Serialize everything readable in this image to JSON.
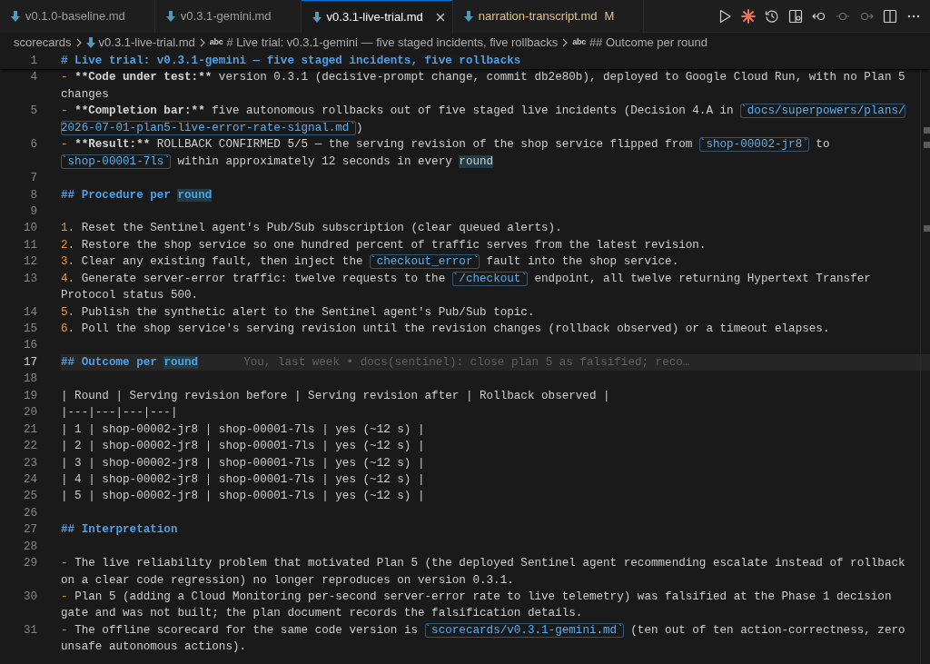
{
  "tabs": [
    {
      "label": "v0.1.0-baseline.md",
      "selected": false,
      "modified": false
    },
    {
      "label": "v0.3.1-gemini.md",
      "selected": false,
      "modified": false
    },
    {
      "label": "v0.3.1-live-trial.md",
      "selected": true,
      "modified": false
    },
    {
      "label": "narration-transcript.md",
      "selected": false,
      "modified": true,
      "status": "M"
    }
  ],
  "breadcrumbs": [
    {
      "kind": "folder",
      "label": "scorecards"
    },
    {
      "kind": "file",
      "label": "v0.3.1-live-trial.md"
    },
    {
      "kind": "symbol",
      "glyph": "abc",
      "label": "# Live trial: v0.3.1-gemini — five staged incidents, five rollbacks"
    },
    {
      "kind": "symbol",
      "glyph": "abc",
      "label": "## Outcome per round"
    }
  ],
  "editor": {
    "sticky_scroll": {
      "number": "1",
      "kind": "heading",
      "segments": [
        {
          "kind": "text",
          "text": "# Live trial: v0.3.1-gemini — five staged incidents, five rollbacks"
        }
      ]
    },
    "lines": [
      {
        "number": "4",
        "kind": "text",
        "current": false,
        "segments": [
          {
            "kind": "marker",
            "text": "- "
          },
          {
            "kind": "bold",
            "text": "**Code under test:**"
          },
          {
            "kind": "text",
            "text": " version 0.3.1 (decisive-prompt change, commit db2e80b), deployed to Google Cloud Run, with no Plan 5"
          }
        ],
        "continuation": {
          "segments": [
            {
              "kind": "text",
              "text": "changes"
            }
          ]
        }
      },
      {
        "number": "5",
        "kind": "text",
        "current": false,
        "segments": [
          {
            "kind": "marker",
            "text": "- "
          },
          {
            "kind": "bold",
            "text": "**Completion bar:**"
          },
          {
            "kind": "text",
            "text": " five autonomous rollbacks out of five staged live incidents (Decision 4.A in "
          },
          {
            "kind": "code",
            "text": "`docs/superpowers/plans/"
          }
        ],
        "continuation": {
          "segments": [
            {
              "kind": "code",
              "text": "2026-07-01-plan5-live-error-rate-signal.md`"
            },
            {
              "kind": "text",
              "text": ")"
            }
          ]
        }
      },
      {
        "number": "6",
        "kind": "text",
        "current": false,
        "segments": [
          {
            "kind": "marker",
            "text": "- "
          },
          {
            "kind": "bold",
            "text": "**Result:**"
          },
          {
            "kind": "text",
            "text": " ROLLBACK CONFIRMED 5/5 — the serving revision of the shop service flipped from "
          },
          {
            "kind": "code",
            "text": "`shop-00002-jr8`"
          },
          {
            "kind": "text",
            "text": " to"
          }
        ],
        "continuation": {
          "segments": [
            {
              "kind": "code",
              "text": "`shop-00001-7ls`"
            },
            {
              "kind": "text",
              "text": " within approximately 12 seconds in every "
            },
            {
              "kind": "match",
              "text": "round"
            }
          ]
        }
      },
      {
        "number": "7",
        "kind": "blank",
        "current": false
      },
      {
        "number": "8",
        "kind": "heading",
        "current": false,
        "segments": [
          {
            "kind": "text",
            "text": "## Procedure per "
          },
          {
            "kind": "match",
            "text": "round"
          }
        ]
      },
      {
        "number": "9",
        "kind": "blank",
        "current": false
      },
      {
        "number": "10",
        "kind": "text",
        "current": false,
        "segments": [
          {
            "kind": "marker",
            "text": "1."
          },
          {
            "kind": "text",
            "text": " Reset the Sentinel agent's Pub/Sub subscription (clear queued alerts)."
          }
        ]
      },
      {
        "number": "11",
        "kind": "text",
        "current": false,
        "segments": [
          {
            "kind": "marker",
            "text": "2."
          },
          {
            "kind": "text",
            "text": " Restore the shop service so one hundred percent of traffic serves from the latest revision."
          }
        ]
      },
      {
        "number": "12",
        "kind": "text",
        "current": false,
        "segments": [
          {
            "kind": "marker",
            "text": "3."
          },
          {
            "kind": "text",
            "text": " Clear any existing fault, then inject the "
          },
          {
            "kind": "code",
            "text": "`checkout_error`"
          },
          {
            "kind": "text",
            "text": " fault into the shop service."
          }
        ]
      },
      {
        "number": "13",
        "kind": "text",
        "current": false,
        "segments": [
          {
            "kind": "marker",
            "text": "4."
          },
          {
            "kind": "text",
            "text": " Generate server-error traffic: twelve requests to the "
          },
          {
            "kind": "code",
            "text": "`/checkout`"
          },
          {
            "kind": "text",
            "text": " endpoint, all twelve returning Hypertext Transfer"
          }
        ],
        "continuation": {
          "segments": [
            {
              "kind": "text",
              "text": "Protocol status 500."
            }
          ]
        }
      },
      {
        "number": "14",
        "kind": "text",
        "current": false,
        "segments": [
          {
            "kind": "marker",
            "text": "5."
          },
          {
            "kind": "text",
            "text": " Publish the synthetic alert to the Sentinel agent's Pub/Sub topic."
          }
        ]
      },
      {
        "number": "15",
        "kind": "text",
        "current": false,
        "segments": [
          {
            "kind": "marker",
            "text": "6."
          },
          {
            "kind": "text",
            "text": " Poll the shop service's serving revision until the revision changes (rollback observed) or a timeout elapses."
          }
        ]
      },
      {
        "number": "16",
        "kind": "blank",
        "current": false
      },
      {
        "number": "17",
        "kind": "heading",
        "current": true,
        "segments": [
          {
            "kind": "text",
            "text": "## Outcome per "
          },
          {
            "kind": "match",
            "text": "round"
          }
        ],
        "blame": "You, last week • docs(sentinel): close plan 5 as falsified; reco…"
      },
      {
        "number": "18",
        "kind": "blank",
        "current": false
      },
      {
        "number": "19",
        "kind": "text",
        "current": false,
        "segments": [
          {
            "kind": "text",
            "text": "| Round | Serving revision before | Serving revision after | Rollback observed |"
          }
        ]
      },
      {
        "number": "20",
        "kind": "text",
        "current": false,
        "segments": [
          {
            "kind": "text",
            "text": "|---|---|---|---|"
          }
        ]
      },
      {
        "number": "21",
        "kind": "text",
        "current": false,
        "segments": [
          {
            "kind": "text",
            "text": "| 1 | shop-00002-jr8 | shop-00001-7ls | yes (~12 s) |"
          }
        ]
      },
      {
        "number": "22",
        "kind": "text",
        "current": false,
        "segments": [
          {
            "kind": "text",
            "text": "| 2 | shop-00002-jr8 | shop-00001-7ls | yes (~12 s) |"
          }
        ]
      },
      {
        "number": "23",
        "kind": "text",
        "current": false,
        "segments": [
          {
            "kind": "text",
            "text": "| 3 | shop-00002-jr8 | shop-00001-7ls | yes (~12 s) |"
          }
        ]
      },
      {
        "number": "24",
        "kind": "text",
        "current": false,
        "segments": [
          {
            "kind": "text",
            "text": "| 4 | shop-00002-jr8 | shop-00001-7ls | yes (~12 s) |"
          }
        ]
      },
      {
        "number": "25",
        "kind": "text",
        "current": false,
        "segments": [
          {
            "kind": "text",
            "text": "| 5 | shop-00002-jr8 | shop-00001-7ls | yes (~12 s) |"
          }
        ]
      },
      {
        "number": "26",
        "kind": "blank",
        "current": false
      },
      {
        "number": "27",
        "kind": "heading",
        "current": false,
        "segments": [
          {
            "kind": "text",
            "text": "## Interpretation"
          }
        ]
      },
      {
        "number": "28",
        "kind": "blank",
        "current": false
      },
      {
        "number": "29",
        "kind": "text",
        "current": false,
        "segments": [
          {
            "kind": "marker",
            "text": "- "
          },
          {
            "kind": "text",
            "text": "The live reliability problem that motivated Plan 5 (the deployed Sentinel agent recommending escalate instead of rollback"
          }
        ],
        "continuation": {
          "segments": [
            {
              "kind": "text",
              "text": "on a clear code regression) no longer reproduces on version 0.3.1."
            }
          ]
        }
      },
      {
        "number": "30",
        "kind": "text",
        "current": false,
        "segments": [
          {
            "kind": "marker",
            "text": "- "
          },
          {
            "kind": "text",
            "text": "Plan 5 (adding a Cloud Monitoring per-second server-error rate to live telemetry) was falsified at the Phase 1 decision"
          }
        ],
        "continuation": {
          "segments": [
            {
              "kind": "text",
              "text": "gate and was not built; the plan document records the falsification details."
            }
          ]
        }
      },
      {
        "number": "31",
        "kind": "text",
        "current": false,
        "segments": [
          {
            "kind": "marker",
            "text": "- "
          },
          {
            "kind": "text",
            "text": "The offline scorecard for the same code version is "
          },
          {
            "kind": "code",
            "text": "`scorecards/v0.3.1-gemini.md`"
          },
          {
            "kind": "text",
            "text": " (ten out of ten action-correctness, zero"
          }
        ],
        "continuation": {
          "segments": [
            {
              "kind": "text",
              "text": "unsafe autonomous actions)."
            }
          ]
        }
      }
    ]
  }
}
